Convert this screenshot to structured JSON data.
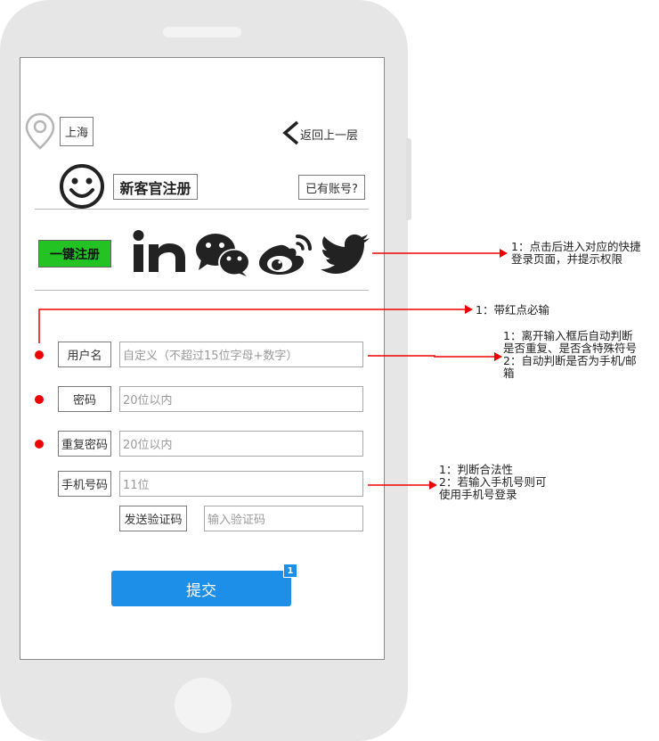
{
  "header": {
    "city": "上海",
    "back_label": "返回上一层"
  },
  "title_row": {
    "title": "新客官注册",
    "has_account": "已有账号?"
  },
  "social": {
    "one_click_label": "一键注册",
    "icons": [
      "linkedin-icon",
      "wechat-icon",
      "weibo-icon",
      "twitter-icon"
    ],
    "one_click_color": "#22c322"
  },
  "form": {
    "username_label": "用户名",
    "username_placeholder": "自定义（不超过15位字母+数字）",
    "password_label": "密码",
    "password_placeholder": "20位以内",
    "repeat_label": "重复密码",
    "repeat_placeholder": "20位以内",
    "phone_label": "手机号码",
    "phone_placeholder": "11位",
    "send_code_label": "发送验证码",
    "code_placeholder": "输入验证码",
    "required_color": "#ee0000"
  },
  "submit": {
    "label": "提交",
    "badge": "1",
    "color": "#1e8fe8"
  },
  "annotations": {
    "social": "1：点击后进入对应的快捷\n登录页面，并提示权限",
    "required": "1：带红点必输",
    "username": "1：离开输入框后自动判断\n是否重复、是否含特殊符号\n2：自动判断是否为手机/邮\n箱",
    "phone": "1：判断合法性\n2：若输入手机号则可\n使用手机号登录"
  }
}
